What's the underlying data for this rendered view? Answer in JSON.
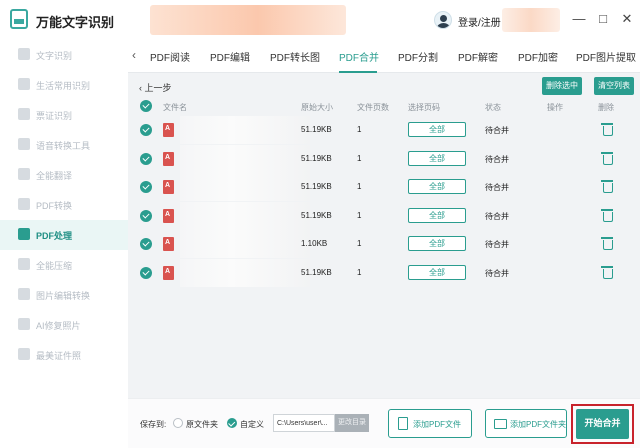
{
  "app": {
    "title": "万能文字识别",
    "login": "登录/注册"
  },
  "window": {
    "minimize": "—",
    "maximize": "□",
    "close": "✕"
  },
  "sidebar": {
    "items": [
      {
        "label": "文字识别",
        "icon": "text-scan-icon"
      },
      {
        "label": "生活常用识别",
        "icon": "life-scan-icon"
      },
      {
        "label": "票证识别",
        "icon": "ticket-icon"
      },
      {
        "label": "语音转换工具",
        "icon": "voice-icon"
      },
      {
        "label": "全能翻译",
        "icon": "translate-icon"
      },
      {
        "label": "PDF转换",
        "icon": "pdf-convert-icon"
      },
      {
        "label": "PDF处理",
        "icon": "pdf-process-icon",
        "active": true
      },
      {
        "label": "全能压缩",
        "icon": "compress-icon"
      },
      {
        "label": "图片编辑转换",
        "icon": "image-edit-icon"
      },
      {
        "label": "AI修复照片",
        "icon": "ai-repair-icon"
      },
      {
        "label": "最美证件照",
        "icon": "id-photo-icon"
      }
    ]
  },
  "tabs": {
    "arrow": "‹",
    "items": [
      "PDF阅读",
      "PDF编辑",
      "PDF转长图",
      "PDF合并",
      "PDF分割",
      "PDF解密",
      "PDF加密",
      "PDF图片提取"
    ],
    "active": "PDF合并"
  },
  "toolbar": {
    "back": "上一步",
    "delete_selected": "删除选中",
    "clear_list": "清空列表"
  },
  "table": {
    "headers": {
      "filename": "文件名",
      "size": "原始大小",
      "pages": "文件页数",
      "page_select": "选择页码",
      "status": "状态",
      "action": "操作",
      "delete": "删除"
    },
    "rows": [
      {
        "size": "51.19KB",
        "pages": "1",
        "page_select": "全部",
        "status": "待合并"
      },
      {
        "size": "51.19KB",
        "pages": "1",
        "page_select": "全部",
        "status": "待合并"
      },
      {
        "size": "51.19KB",
        "pages": "1",
        "page_select": "全部",
        "status": "待合并"
      },
      {
        "size": "51.19KB",
        "pages": "1",
        "page_select": "全部",
        "status": "待合并"
      },
      {
        "size": "1.10KB",
        "pages": "1",
        "page_select": "全部",
        "status": "待合并"
      },
      {
        "size": "51.19KB",
        "pages": "1",
        "page_select": "全部",
        "status": "待合并"
      }
    ]
  },
  "bottom": {
    "save_to": "保存到:",
    "option_original": "原文件夹",
    "option_custom": "自定义",
    "selected_option": "自定义",
    "path": "C:\\Users\\user\\...",
    "change_dir": "更改目录",
    "add_file": "添加PDF文件",
    "add_folder": "添加PDF文件夹",
    "start": "开始合并"
  },
  "colors": {
    "accent": "#2a9d8f",
    "highlight_border": "#c8232c",
    "pdf_icon": "#d9534f"
  }
}
